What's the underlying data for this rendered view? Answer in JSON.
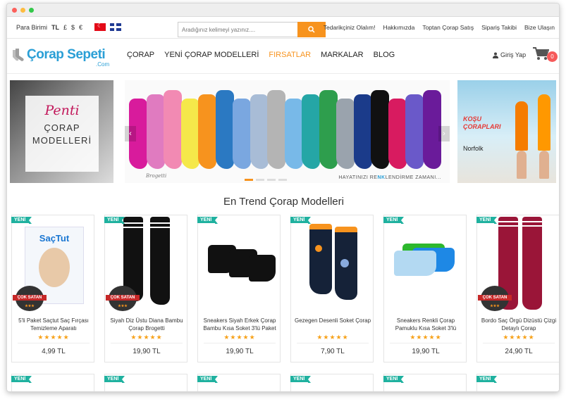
{
  "topbar": {
    "currency_label": "Para Birimi",
    "currencies": [
      "TL",
      "£",
      "$",
      "€"
    ],
    "search_placeholder": "Aradığınız kelimeyi yazınız....",
    "links": [
      "Tedarikçiniz Olalım!",
      "Hakkımızda",
      "Toptan Çorap Satış",
      "Sipariş Takibi",
      "Bize Ulaşın"
    ]
  },
  "nav": {
    "logo": "Çorap Sepeti",
    "logo_suffix": ".Com",
    "menu": [
      "ÇORAP",
      "YENİ ÇORAP MODELLERİ",
      "FIRSATLAR",
      "MARKALAR",
      "BLOG"
    ],
    "login": "Giriş Yap",
    "cart_count": "0"
  },
  "banners": {
    "penti_brand": "Penti",
    "penti_line1": "ÇORAP",
    "penti_line2": "MODELLERİ",
    "slider_brand": "Brogetti",
    "slider_caption_pre": "HAYATINIZI RE",
    "slider_caption_mid": "NK",
    "slider_caption_post": "LENDİRME ZAMANI...",
    "runner_title_1": "KOŞU",
    "runner_title_2": "ÇORAPLARI",
    "runner_brand": "Norfolk"
  },
  "section_title": "En Trend Çorap Modelleri",
  "badge_new": "YENİ",
  "badge_best": "ÇOK SATAN",
  "products": [
    {
      "name": "5'li Paket Saçtut Saç Fırçası Temizleme Aparatı",
      "price": "4,99 TL",
      "rating": 5,
      "best": true
    },
    {
      "name": "Siyah Diz Üstu Diana Bambu Çorap Brogetti",
      "price": "19,90 TL",
      "rating": 5,
      "best": true
    },
    {
      "name": "Sneakers Siyah Erkek Çorap Bambu Kısa Soket 3'lü Paket",
      "price": "19,90 TL",
      "rating": 5,
      "best": false
    },
    {
      "name": "Gezegen Desenli Soket Çorap",
      "price": "7,90 TL",
      "rating": 5,
      "best": false
    },
    {
      "name": "Sneakers Renkli Çorap Pamuklu Kısa Soket 3'lü",
      "price": "19,90 TL",
      "rating": 5,
      "best": false
    },
    {
      "name": "Bordo Saç Örgü Dizüstü Çizgi Detaylı Çorap",
      "price": "24,90 TL",
      "rating": 5,
      "best": true
    }
  ],
  "colors": {
    "accent": "#f7931e",
    "brand_blue": "#2a9fd6",
    "new_badge": "#1fb19f",
    "star": "#f7a21b"
  }
}
